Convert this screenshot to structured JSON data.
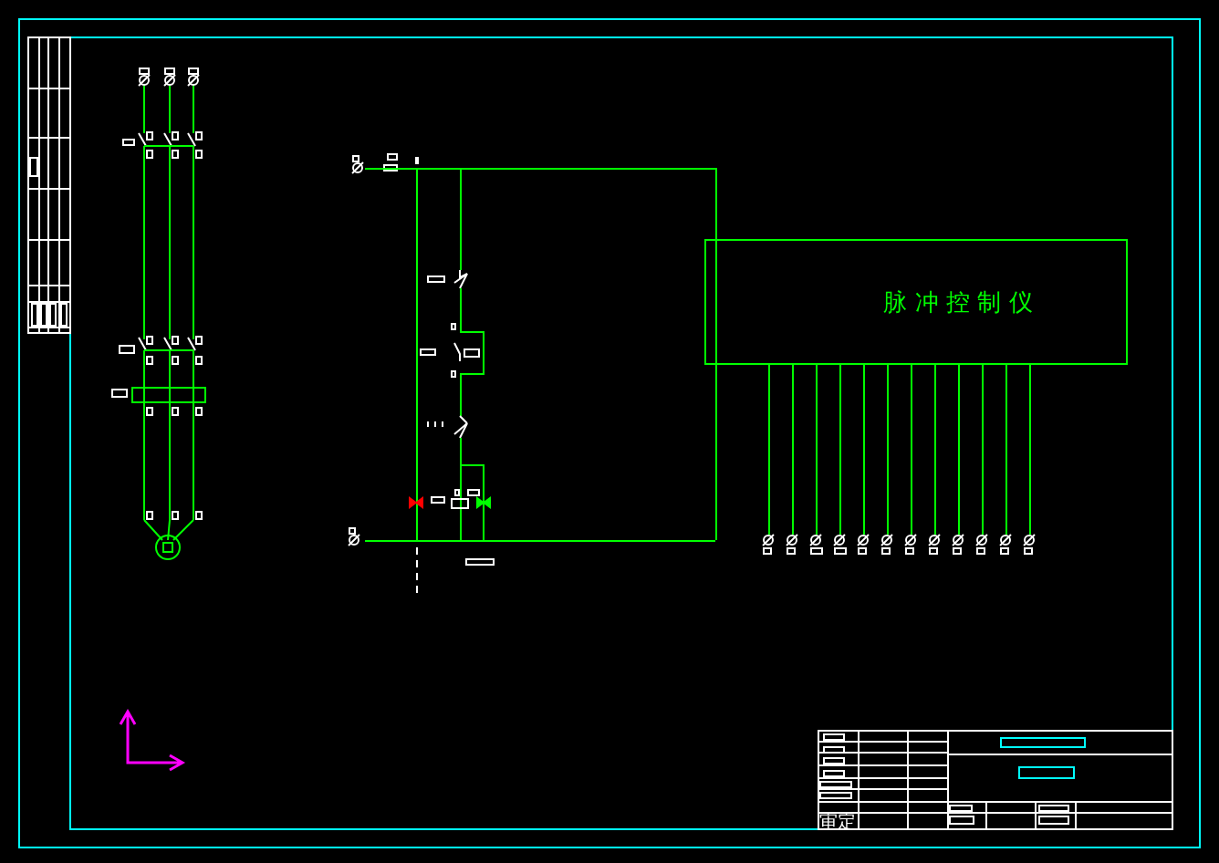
{
  "controller_box": {
    "label": "脉 冲 控 制 仪"
  },
  "title_block": {
    "label": "审定"
  }
}
